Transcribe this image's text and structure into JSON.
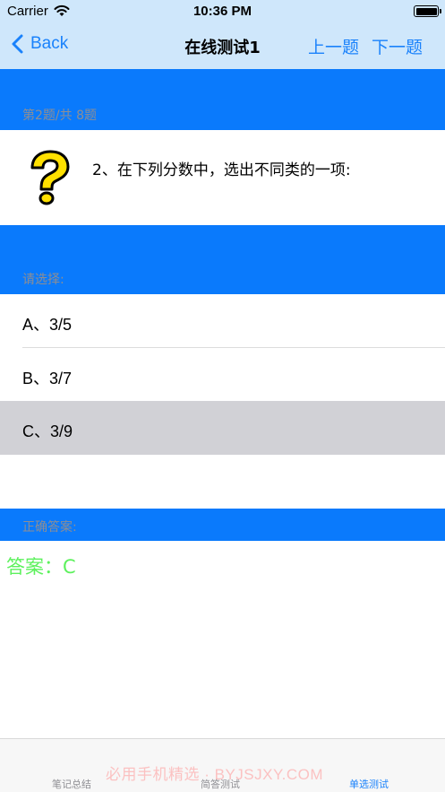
{
  "status_bar": {
    "carrier": "Carrier",
    "time": "10:36 PM"
  },
  "nav": {
    "back_label": "Back",
    "title": "在线测试1",
    "prev_label": "上一题",
    "next_label": "下一题"
  },
  "question": {
    "progress": "第2题/共 8题",
    "text": "2、在下列分数中，选出不同类的一项:"
  },
  "options": {
    "section_label": "请选择:",
    "items": [
      {
        "label": "A、3/5",
        "selected": false
      },
      {
        "label": "B、3/7",
        "selected": false
      },
      {
        "label": "C、3/9",
        "selected": true
      }
    ]
  },
  "answer": {
    "section_label": "正确答案:",
    "text": "答案：C"
  },
  "tab_bar": {
    "tabs": [
      {
        "label": "笔记总结",
        "active": false
      },
      {
        "label": "简答测试",
        "active": false
      },
      {
        "label": "单选测试",
        "active": true
      }
    ],
    "watermark": "必用手机精选 · BYJSJXY.COM"
  },
  "colors": {
    "accent": "#1a82fb",
    "band": "#0a7afc",
    "answer": "#5df15d",
    "selected_row": "#d1d1d6"
  }
}
